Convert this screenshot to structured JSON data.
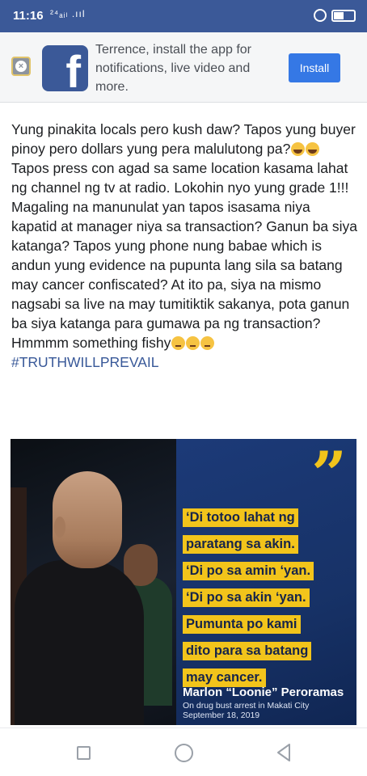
{
  "status_bar": {
    "time": "11:16",
    "signal": "²⁴ₐᵢₗ .ııl",
    "colors": {
      "background": "#3b5998"
    }
  },
  "banner": {
    "text": "Terrence, install the app for notifications, live video and more.",
    "install_label": "Install",
    "logo_letter": "f",
    "close_icon": "close-icon"
  },
  "post": {
    "paragraphs": [
      "Yung pinakita locals pero kush daw? Tapos yung buyer pinoy pero dollars yung pera malulutong pa?",
      "Tapos press con agad sa same location kasama lahat ng channel ng tv at radio. Lokohin nyo yung grade 1!!!",
      "Magaling na manunulat yan tapos isasama niya kapatid at manager niya sa transaction? Ganun ba siya katanga? Tapos yung phone nung babae which is andun yung evidence na pupunta lang sila sa batang may cancer confiscated? At ito pa, siya na mismo nagsabi sa live na may tumitiktik sakanya, pota ganun ba siya katanga para gumawa pa ng transaction? Hmmmm something fishy"
    ],
    "hashtag": "#TRUTHWILLPREVAIL"
  },
  "image": {
    "quote_mark": "”",
    "quote_lines": [
      "‘Di totoo lahat ng",
      "paratang sa akin.",
      "‘Di po sa amin ‘yan.",
      "‘Di po sa akin ‘yan.",
      "Pumunta po kami",
      "dito para sa batang",
      "may cancer."
    ],
    "author": "Marlon “Loonie” Peroramas",
    "caption": "On drug bust arrest in Makati City\nSeptember 18, 2019",
    "colors": {
      "quote_bg": "#f2c41b",
      "panel": "#1c3a78"
    }
  },
  "nav": {
    "icons": [
      "recent-apps-icon",
      "home-icon",
      "back-icon"
    ]
  }
}
